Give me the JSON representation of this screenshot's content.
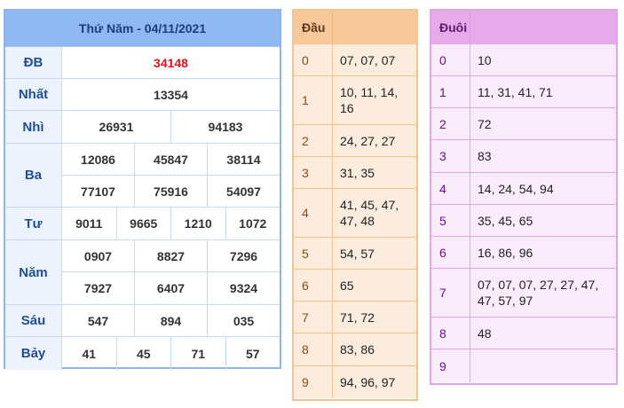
{
  "results": {
    "header": "Thứ Năm - 04/11/2021",
    "prizes": [
      {
        "label": "ĐB",
        "lines": [
          [
            "34148"
          ]
        ],
        "highlight": true
      },
      {
        "label": "Nhất",
        "lines": [
          [
            "13354"
          ]
        ]
      },
      {
        "label": "Nhì",
        "lines": [
          [
            "26931",
            "94183"
          ]
        ]
      },
      {
        "label": "Ba",
        "lines": [
          [
            "12086",
            "45847",
            "38114"
          ],
          [
            "77107",
            "75916",
            "54097"
          ]
        ]
      },
      {
        "label": "Tư",
        "lines": [
          [
            "9011",
            "9665",
            "1210",
            "1072"
          ]
        ]
      },
      {
        "label": "Năm",
        "lines": [
          [
            "0907",
            "8827",
            "7296"
          ],
          [
            "7927",
            "6407",
            "9324"
          ]
        ]
      },
      {
        "label": "Sáu",
        "lines": [
          [
            "547",
            "894",
            "035"
          ]
        ]
      },
      {
        "label": "Bảy",
        "lines": [
          [
            "41",
            "45",
            "71",
            "57"
          ]
        ]
      }
    ]
  },
  "dau": {
    "header_key": "Đầu",
    "header_val": "",
    "rows": [
      {
        "k": "0",
        "v": "07, 07, 07"
      },
      {
        "k": "1",
        "v": "10, 11, 14, 16"
      },
      {
        "k": "2",
        "v": "24, 27, 27"
      },
      {
        "k": "3",
        "v": "31, 35"
      },
      {
        "k": "4",
        "v": "41, 45, 47, 47, 48"
      },
      {
        "k": "5",
        "v": "54, 57"
      },
      {
        "k": "6",
        "v": "65"
      },
      {
        "k": "7",
        "v": "71, 72"
      },
      {
        "k": "8",
        "v": "83, 86"
      },
      {
        "k": "9",
        "v": "94, 96, 97"
      }
    ]
  },
  "duoi": {
    "header_key": "Đuôi",
    "header_val": "",
    "rows": [
      {
        "k": "0",
        "v": "10"
      },
      {
        "k": "1",
        "v": "11, 31, 41, 71"
      },
      {
        "k": "2",
        "v": "72"
      },
      {
        "k": "3",
        "v": "83"
      },
      {
        "k": "4",
        "v": "14, 24, 54, 94"
      },
      {
        "k": "5",
        "v": "35, 45, 65"
      },
      {
        "k": "6",
        "v": "16, 86, 96"
      },
      {
        "k": "7",
        "v": "07, 07, 07, 27, 27, 47, 47, 57, 97"
      },
      {
        "k": "8",
        "v": "48"
      },
      {
        "k": "9",
        "v": ""
      }
    ]
  },
  "colors": {
    "special_prize": "#e0141e",
    "results_border": "#8fb6ea",
    "dau_header": "#f9c89a",
    "duoi_header": "#e6a9ea"
  }
}
